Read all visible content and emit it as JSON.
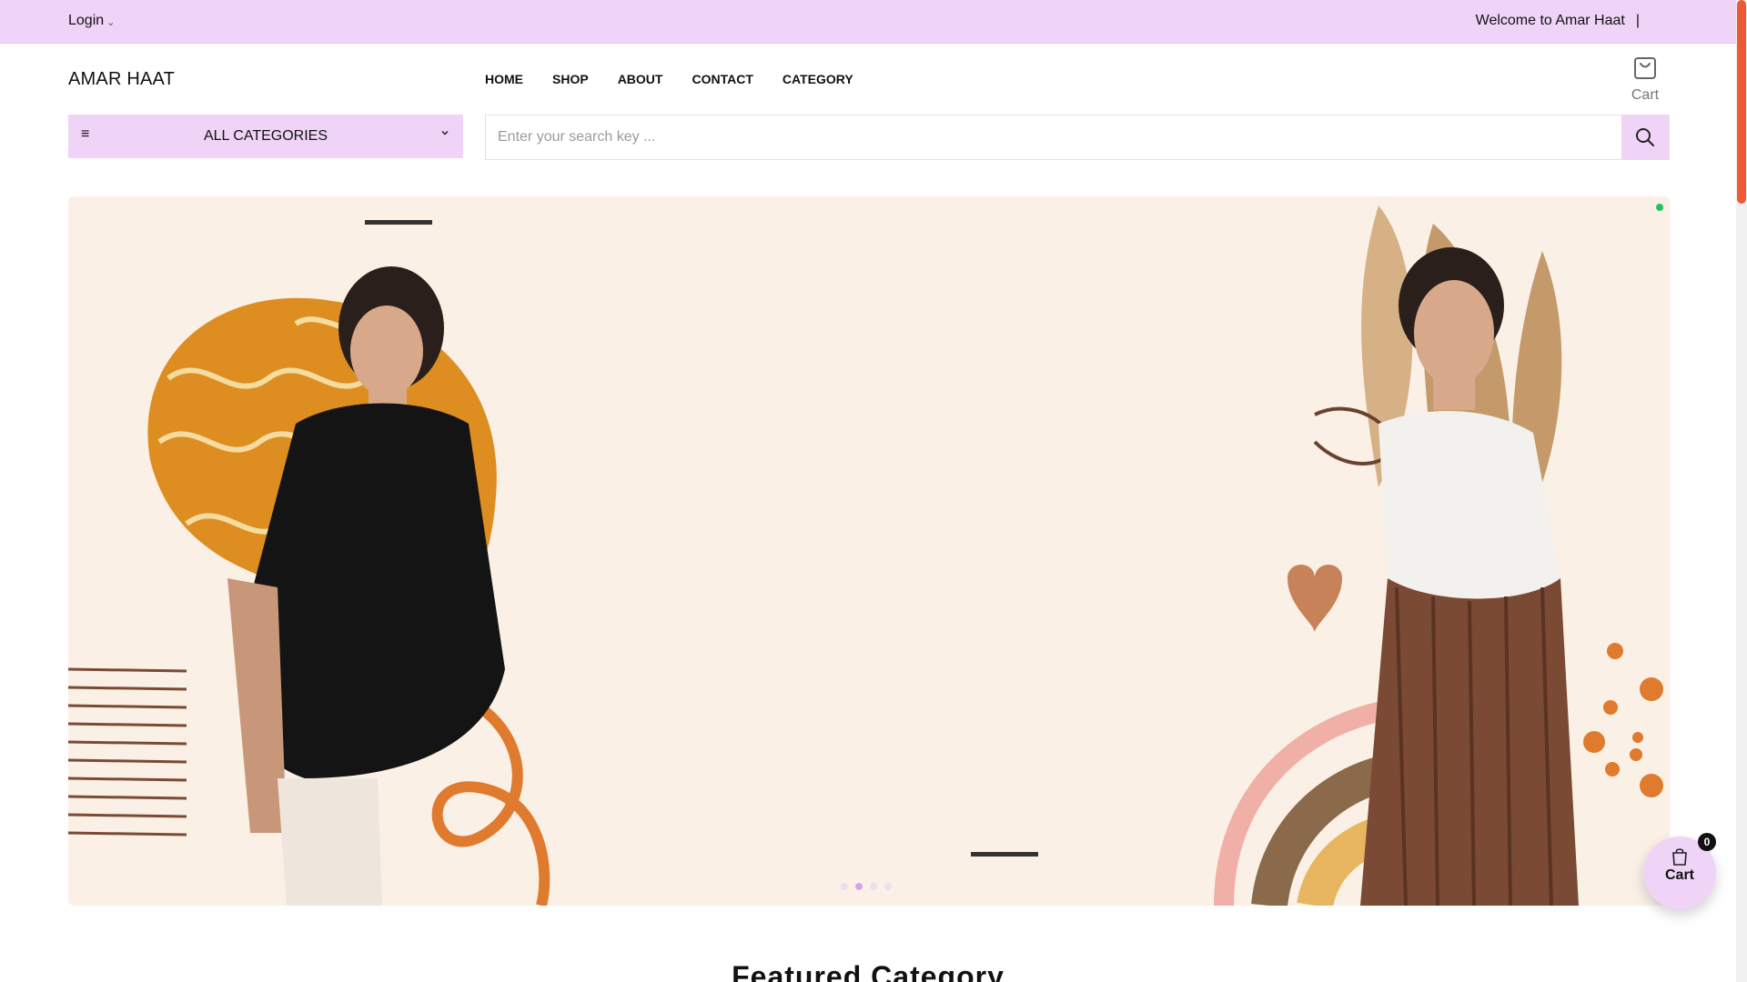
{
  "topbar": {
    "login_label": "Login",
    "welcome_text": "Welcome to Amar Haat",
    "separator": "|"
  },
  "header": {
    "brand": "AMAR HAAT",
    "nav": [
      "HOME",
      "SHOP",
      "ABOUT",
      "CONTACT",
      "CATEGORY"
    ],
    "cart_label": "Cart"
  },
  "categories": {
    "label": "ALL CATEGORIES"
  },
  "search": {
    "placeholder": "Enter your search key ...",
    "value": ""
  },
  "hero": {
    "slide_count": 4,
    "active_slide": 2,
    "background_color": "#faf0e6"
  },
  "floating_cart": {
    "label": "Cart",
    "count": "0"
  },
  "section": {
    "featured_title": "Featured Category"
  },
  "colors": {
    "accent": "#efd4f7",
    "scroll_thumb": "#ee5a36",
    "status_dot": "#22c55e"
  },
  "icons": [
    "chevron-down-icon",
    "hamburger-icon",
    "search-icon",
    "shopping-bag-icon"
  ]
}
